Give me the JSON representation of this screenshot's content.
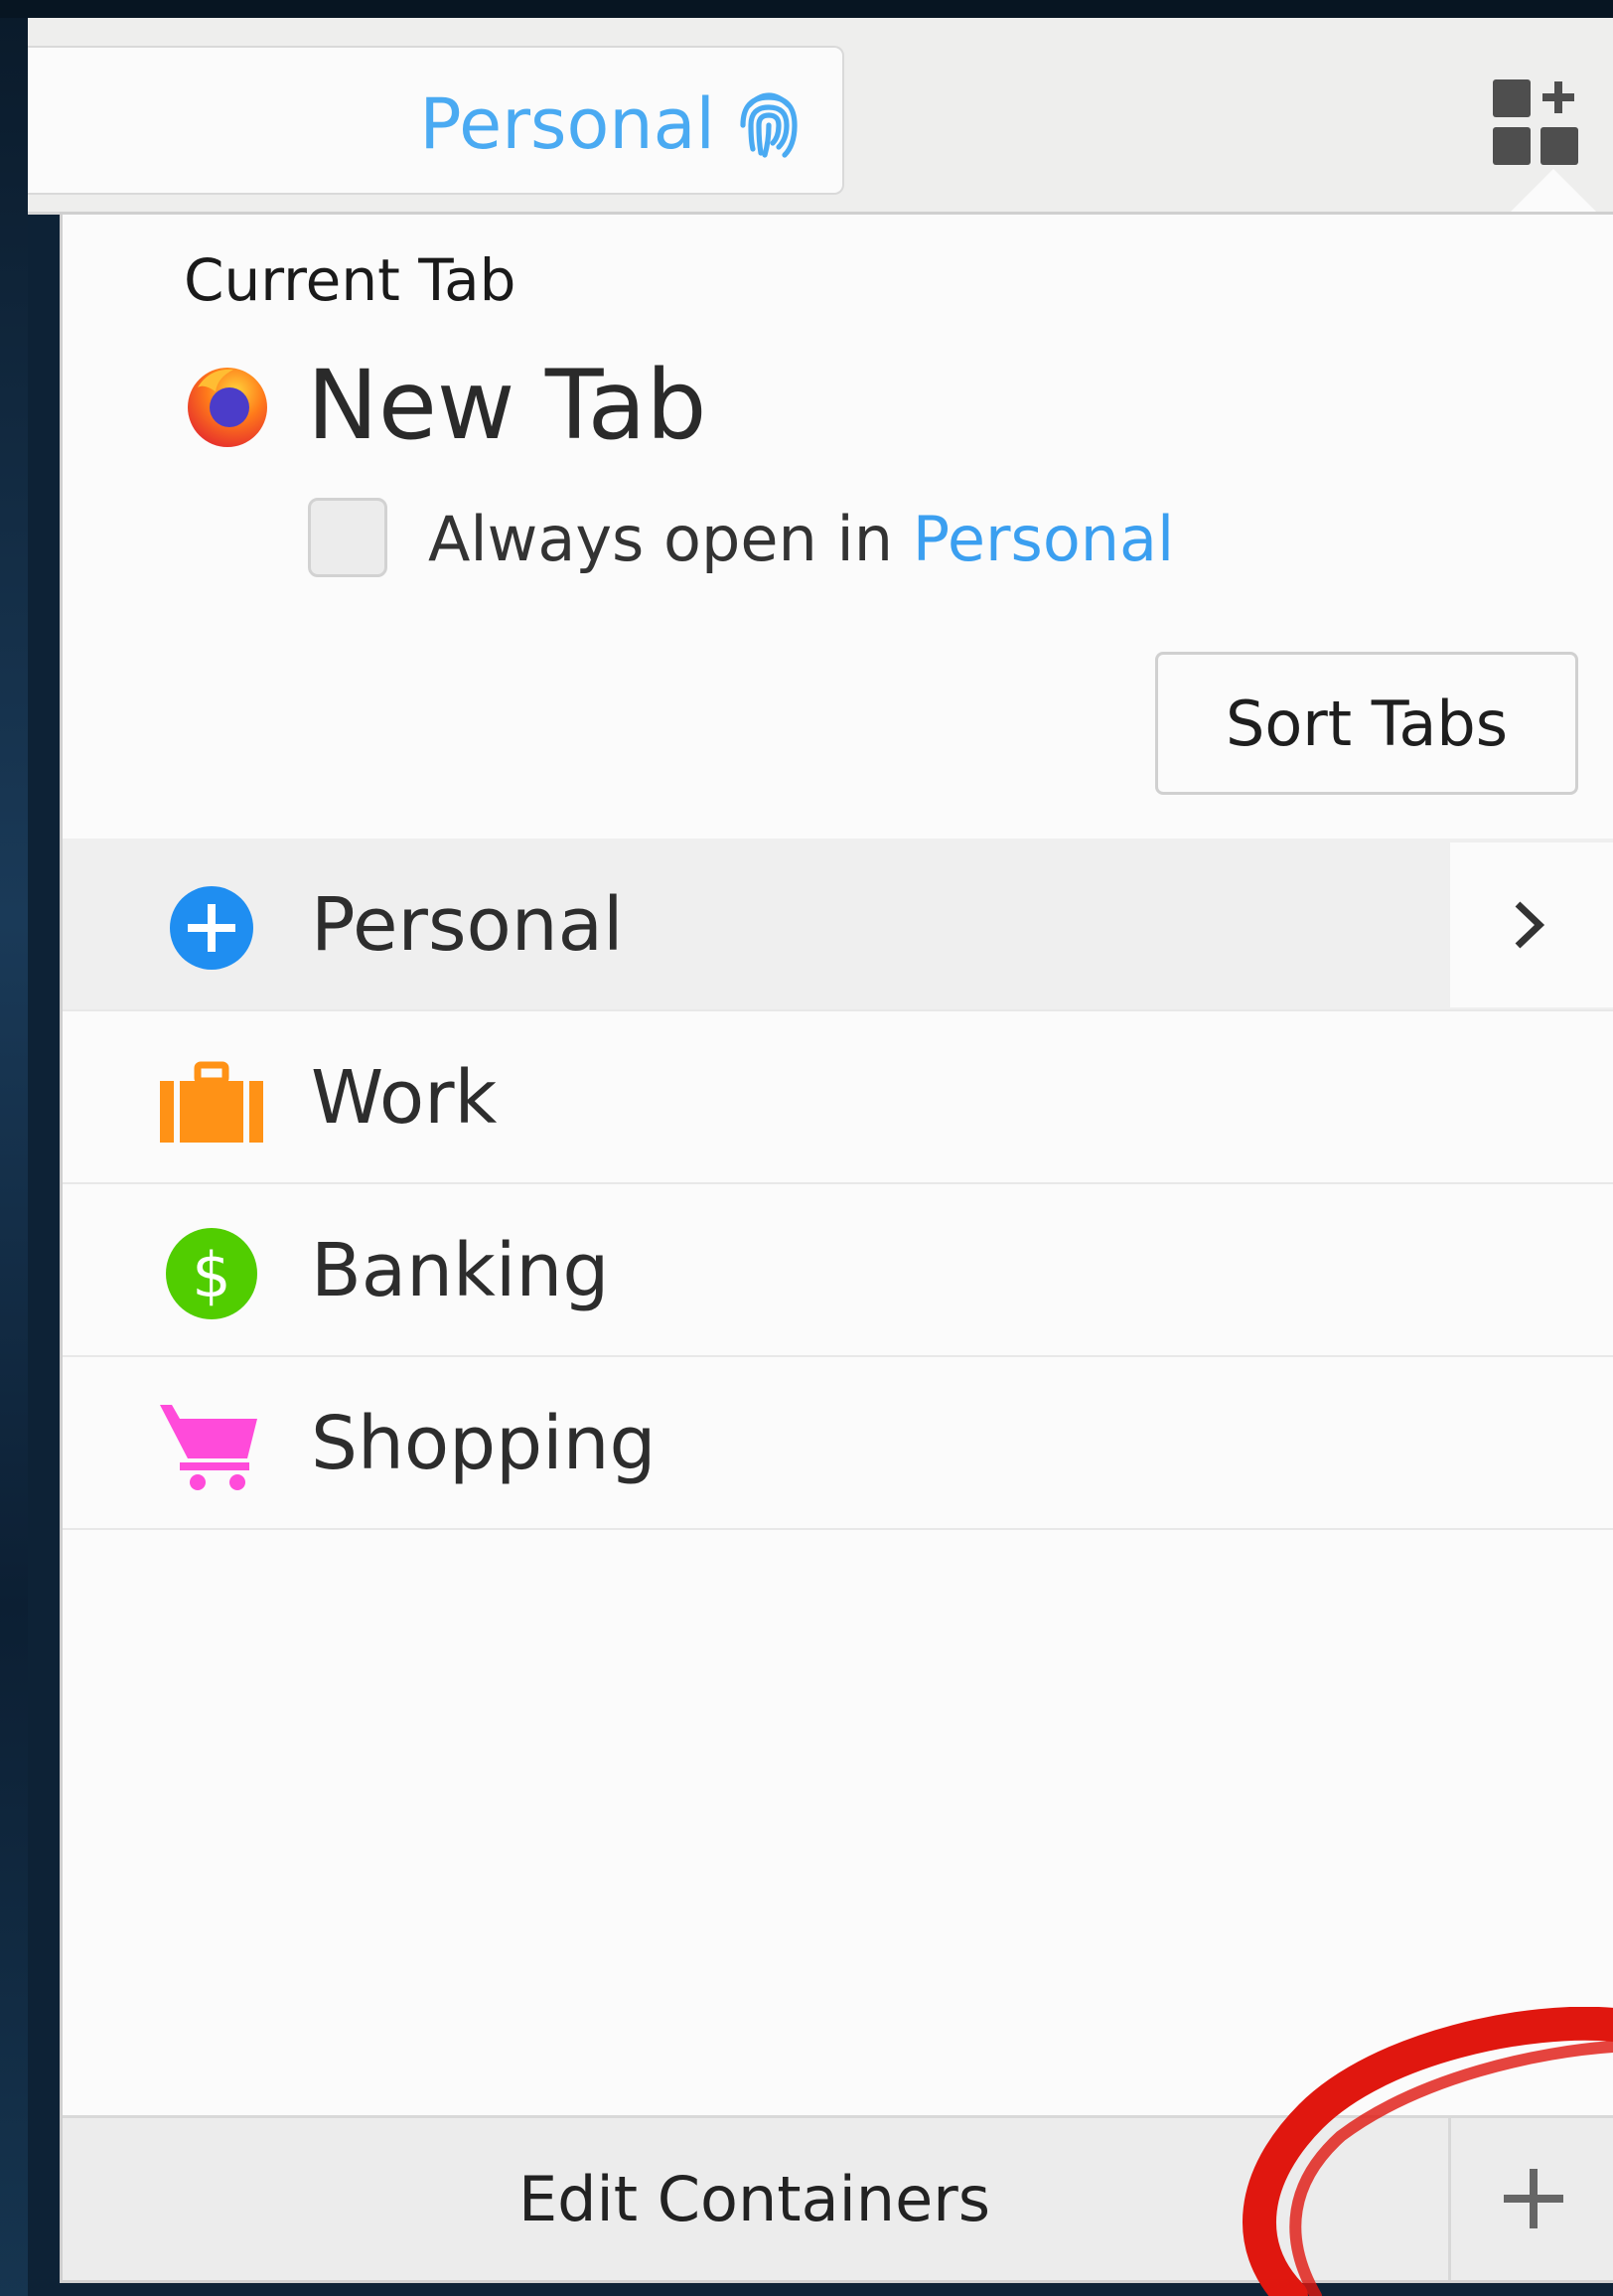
{
  "toolbar": {
    "container_label": "Personal",
    "container_color": "#4aaaf2",
    "container_icon": "fingerprint-icon",
    "extension_icon": "containers-toolbar-icon"
  },
  "panel": {
    "heading": "Current Tab",
    "tab": {
      "title": "New Tab",
      "icon": "firefox-icon"
    },
    "always_open": {
      "prefix": "Always open in ",
      "container": "Personal",
      "checked": false
    },
    "sort_button": "Sort Tabs",
    "containers": [
      {
        "name": "Personal",
        "icon": "plus-circle-icon",
        "color": "#1f8ef1"
      },
      {
        "name": "Work",
        "icon": "briefcase-icon",
        "color": "#ff9216"
      },
      {
        "name": "Banking",
        "icon": "dollar-icon",
        "color": "#51cd00"
      },
      {
        "name": "Shopping",
        "icon": "cart-icon",
        "color": "#ff4bda"
      }
    ],
    "footer": {
      "edit_label": "Edit Containers",
      "add_icon": "plus-icon"
    }
  }
}
